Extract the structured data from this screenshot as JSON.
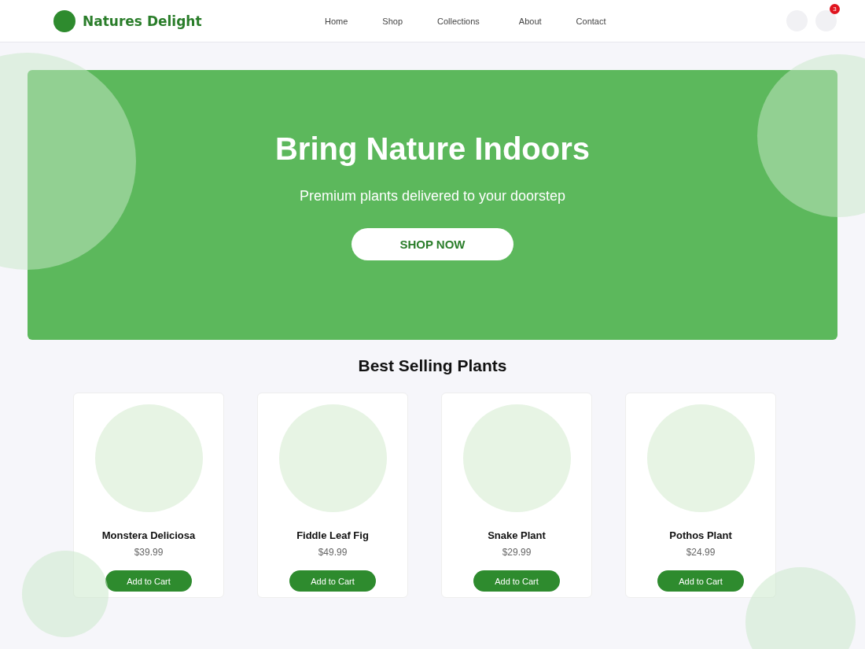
{
  "header": {
    "brand": "Natures Delight",
    "nav": [
      {
        "label": "Home"
      },
      {
        "label": "Shop"
      },
      {
        "label": "Collections"
      },
      {
        "label": "About"
      },
      {
        "label": "Contact"
      }
    ],
    "cart_count": "3"
  },
  "hero": {
    "title": "Bring Nature Indoors",
    "subtitle": "Premium plants delivered to your doorstep",
    "button": "SHOP NOW"
  },
  "section_title": "Best Selling Plants",
  "products": [
    {
      "name": "Monstera Deliciosa",
      "price": "$39.99",
      "button": "Add to Cart"
    },
    {
      "name": "Fiddle Leaf Fig",
      "price": "$49.99",
      "button": "Add to Cart"
    },
    {
      "name": "Snake Plant",
      "price": "$29.99",
      "button": "Add to Cart"
    },
    {
      "name": "Pothos Plant",
      "price": "$24.99",
      "button": "Add to Cart"
    }
  ]
}
